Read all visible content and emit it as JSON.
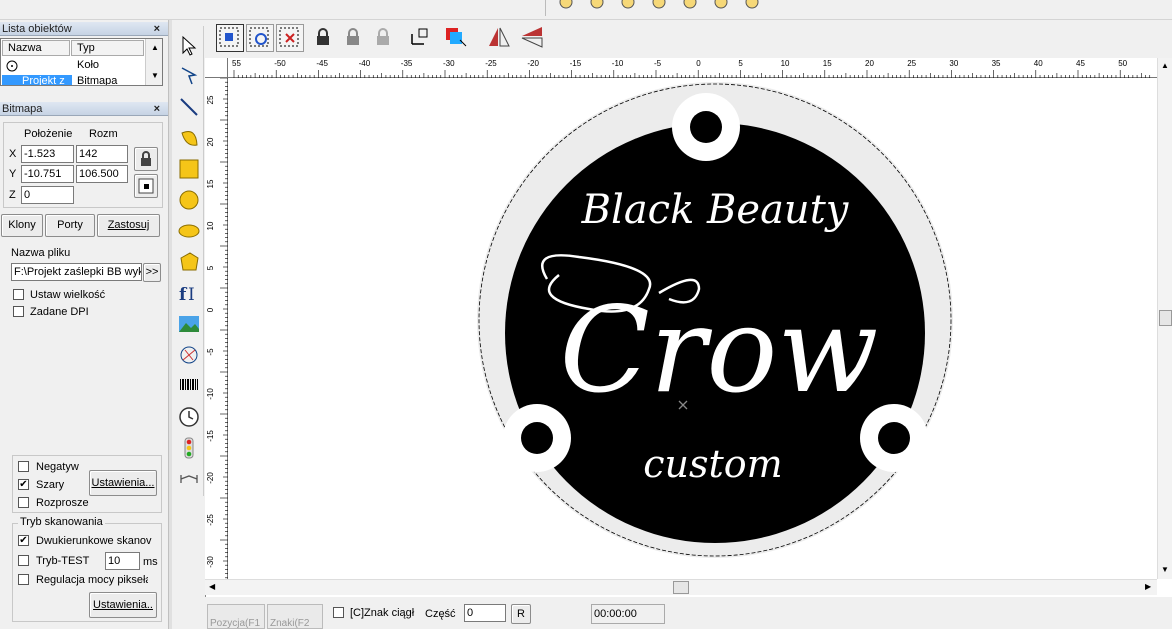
{
  "object_list": {
    "title": "Lista obiektów",
    "close": "×",
    "columns": [
      "Nazwa",
      "Typ"
    ],
    "rows": [
      {
        "name": "",
        "type": "Koło"
      },
      {
        "name": "Projekt z",
        "type": "Bitmapa"
      }
    ]
  },
  "bitmap_panel": {
    "title": "Bitmapa",
    "close": "×",
    "col_position": "Położenie",
    "col_size": "Rozm",
    "x_label": "X",
    "y_label": "Y",
    "z_label": "Z",
    "x_pos": "-1.523",
    "x_size": "142",
    "y_pos": "-10.751",
    "y_size": "106.500",
    "z_val": "0",
    "btn_clones": "Klony",
    "btn_ports": "Porty",
    "btn_apply": "Zastosuj",
    "file_label": "Nazwa pliku",
    "file_value": "F:\\Projekt zaślepki BB wyk",
    "browse": ">>",
    "set_size": "Ustaw wielkość",
    "set_dpi": "Zadane DPI",
    "negative": "Negatyw",
    "gray": "Szary",
    "dither": "Rozprosze",
    "settings1": "Ustawienia...",
    "scan_group": "Tryb skanowania",
    "bidirectional": "Dwukierunkowe skanov",
    "test_mode": "Tryb-TEST",
    "test_ms": "10",
    "ms": "ms",
    "pixel_power": "Regulacja mocy pikseła",
    "settings2": "Ustawienia.."
  },
  "toolbar": {
    "icons": [
      "select-group-icon",
      "node-edit-icon",
      "delete-node-icon",
      "lock-icon",
      "unlock-icon",
      "lock-grey-icon",
      "origin-icon",
      "layer-color-icon",
      "mirror-horizontal-icon",
      "mirror-vertical-icon"
    ]
  },
  "zoom_icons": [
    "zoom-1",
    "zoom-2",
    "zoom-3",
    "zoom-4",
    "zoom-5",
    "zoom-6",
    "zoom-7"
  ],
  "tools": [
    "pointer-icon",
    "node-edit-icon",
    "line-icon",
    "curve-icon",
    "rectangle-icon",
    "circle-icon",
    "ellipse-icon",
    "polygon-icon",
    "text-icon",
    "image-icon",
    "vector-file-icon",
    "barcode-icon",
    "clock-icon",
    "traffic-light-icon",
    "extend-icon"
  ],
  "ruler": {
    "h_labels": [
      "55",
      "-50",
      "-45",
      "-40",
      "-35",
      "-30",
      "-25",
      "-20",
      "-15",
      "-10",
      "-5",
      "0",
      "5",
      "10",
      "15",
      "20",
      "25",
      "30",
      "35",
      "40",
      "45",
      "50"
    ],
    "v_labels": [
      "25",
      "20",
      "15",
      "10",
      "5",
      "0",
      "-5",
      "-10",
      "-15",
      "-20",
      "-25",
      "-30"
    ]
  },
  "artwork": {
    "line1": "Black Beauty",
    "line2": "Crow",
    "line3": "custom"
  },
  "status": {
    "tab_position": "Pozycja(F1",
    "tab_chars": "Znaki(F2",
    "continuous": "[C]Znak ciągł",
    "part_label": "Część",
    "part_value": "0",
    "r_button": "R",
    "time": "00:00:00"
  }
}
